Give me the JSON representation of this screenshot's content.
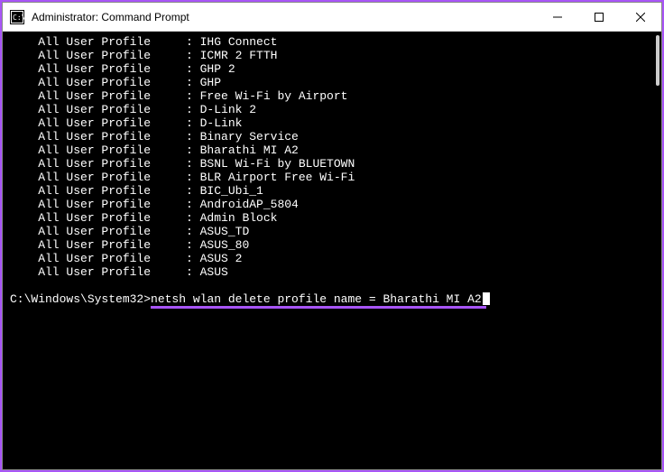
{
  "titlebar": {
    "title": "Administrator: Command Prompt"
  },
  "profiles": [
    {
      "label": "All User Profile",
      "name": "IHG Connect"
    },
    {
      "label": "All User Profile",
      "name": "ICMR 2 FTTH"
    },
    {
      "label": "All User Profile",
      "name": "GHP 2"
    },
    {
      "label": "All User Profile",
      "name": "GHP"
    },
    {
      "label": "All User Profile",
      "name": "Free Wi-Fi by Airport"
    },
    {
      "label": "All User Profile",
      "name": "D-Link 2"
    },
    {
      "label": "All User Profile",
      "name": "D-Link"
    },
    {
      "label": "All User Profile",
      "name": "Binary Service"
    },
    {
      "label": "All User Profile",
      "name": "Bharathi MI A2"
    },
    {
      "label": "All User Profile",
      "name": "BSNL Wi-Fi by BLUETOWN"
    },
    {
      "label": "All User Profile",
      "name": "BLR Airport Free Wi-Fi"
    },
    {
      "label": "All User Profile",
      "name": "BIC_Ubi_1"
    },
    {
      "label": "All User Profile",
      "name": "AndroidAP_5804"
    },
    {
      "label": "All User Profile",
      "name": "Admin Block"
    },
    {
      "label": "All User Profile",
      "name": "ASUS_TD"
    },
    {
      "label": "All User Profile",
      "name": "ASUS_80"
    },
    {
      "label": "All User Profile",
      "name": "ASUS 2"
    },
    {
      "label": "All User Profile",
      "name": "ASUS"
    }
  ],
  "command": {
    "prompt": "C:\\Windows\\System32>",
    "text": "netsh wlan delete profile name = Bharathi MI A2"
  }
}
